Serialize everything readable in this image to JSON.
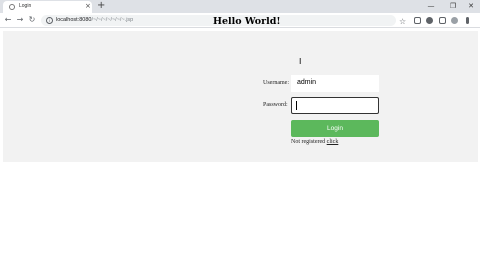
{
  "browser": {
    "tab_title": "Login",
    "tab_close": "×",
    "new_tab": "+",
    "url_host": "localhost:8080",
    "url_path": "/~/~/~/~/~/~/~.jsp",
    "back": "←",
    "forward": "→",
    "reload": "↻",
    "star": "☆",
    "window_minimize": "—",
    "window_maximize": "❐",
    "window_close": "✕"
  },
  "page": {
    "title": "Hello World!",
    "username_label": "Username:",
    "username_value": "admin",
    "password_label": "Password:",
    "password_value": "",
    "login_label": "Login",
    "register_text": "Not registered",
    "register_link": "click"
  },
  "colors": {
    "login_button": "#5cb85c",
    "content_background": "#f2f2f2"
  },
  "icons": [
    "globe-icon",
    "info-icon",
    "star-icon",
    "extension-icon",
    "profile-icon",
    "menu-icon",
    "text-cursor-icon"
  ]
}
